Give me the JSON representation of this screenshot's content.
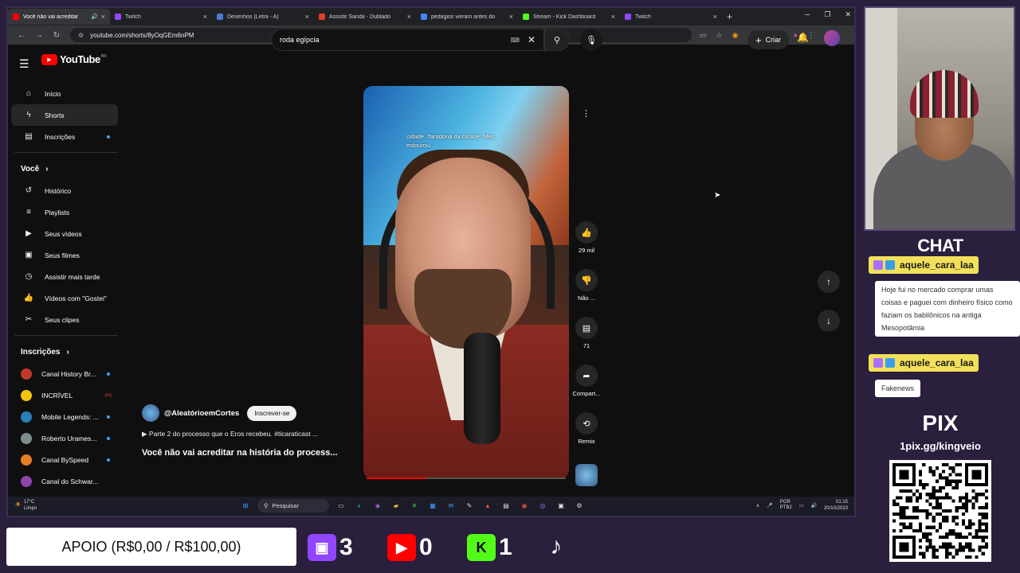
{
  "browser": {
    "tabs": [
      {
        "title": "Você não vai acreditar",
        "color": "#ff0000",
        "active": true,
        "audio": "🔊"
      },
      {
        "title": "Twitch",
        "color": "#9146ff"
      },
      {
        "title": "Desenhos (Letra - A)",
        "color": "#4a7bd6"
      },
      {
        "title": "Assistir Sanda - Dublado",
        "color": "#e63c2a"
      },
      {
        "title": "pedagios vieram antes do",
        "color": "#4285f4"
      },
      {
        "title": "Stream - Kick Dashboard",
        "color": "#53fc18"
      },
      {
        "title": "Twitch",
        "color": "#9146ff"
      }
    ],
    "newtab": "+",
    "close": "×",
    "url": "youtube.com/shorts/8yOqGEm6nPM",
    "controls": {
      "min": "─",
      "max": "❐",
      "close": "✕"
    }
  },
  "youtube": {
    "logo_text": "YouTube",
    "country": "BR",
    "search_value": "roda egípcia",
    "create_label": "Criar",
    "sidebar": {
      "main": [
        {
          "label": "Início",
          "icon": "⌂",
          "name": "home"
        },
        {
          "label": "Shorts",
          "icon": "ϟ",
          "name": "shorts",
          "selected": true
        },
        {
          "label": "Inscrições",
          "icon": "▤",
          "name": "subscriptions",
          "dot": true
        }
      ],
      "voce_header": "Você",
      "voce": [
        {
          "label": "Histórico",
          "icon": "↺",
          "name": "history"
        },
        {
          "label": "Playlists",
          "icon": "≡",
          "name": "playlists"
        },
        {
          "label": "Seus vídeos",
          "icon": "▶",
          "name": "your-videos"
        },
        {
          "label": "Seus filmes",
          "icon": "▣",
          "name": "your-movies"
        },
        {
          "label": "Assistir mais tarde",
          "icon": "◷",
          "name": "watch-later"
        },
        {
          "label": "Vídeos com \"Gostei\"",
          "icon": "👍",
          "name": "liked-videos"
        },
        {
          "label": "Seus clipes",
          "icon": "✂",
          "name": "your-clips"
        }
      ],
      "subs_header": "Inscrições",
      "subs": [
        {
          "label": "Canal History Br...",
          "color": "#c0392b",
          "dot": true
        },
        {
          "label": "INCRÍVEL",
          "color": "#f1c40f",
          "live": true
        },
        {
          "label": "Mobile Legends: ...",
          "color": "#2980b9",
          "dot": true
        },
        {
          "label": "Roberto Urames...",
          "color": "#7f8c8d",
          "dot": true
        },
        {
          "label": "Canal BySpeed",
          "color": "#e67e22",
          "dot": true
        },
        {
          "label": "Canal do Schwar...",
          "color": "#8e44ad"
        }
      ]
    },
    "short": {
      "caption": "cidade. Taradona da cidade. Meu, estourou.",
      "channel": "@AleatórioemCortes",
      "subscribe": "Inscrever-se",
      "description": "▶  Parte 2 do processo que o Eros recebeu. #ticaraticast ...",
      "title": "Você não vai acreditar na história do process...",
      "progress": 0.3
    },
    "actions": {
      "like": "29 mil",
      "dislike": "Não ...",
      "comments": "71",
      "share": "Compart...",
      "remix": "Remix"
    }
  },
  "taskbar": {
    "weather": "17°C\nLimpo",
    "search": "Pesquisar",
    "lang": "POR\nPTB2",
    "time": "01:15",
    "date": "20/10/2023"
  },
  "overlay": {
    "chat_title": "CHAT",
    "messages": [
      {
        "user": "aquele_cara_laa",
        "text": "Hoje fui no mercado comprar umas coisas e paguei com dinheiro físico como faziam os babilônicos na antiga Mesopotâmia"
      },
      {
        "user": "aquele_cara_laa",
        "text": "Fakenews"
      }
    ],
    "pix_title": "PIX",
    "pix_key": "1pix.gg/kingveio",
    "apoio": "APOIO (R$0,00 / R$100,00)",
    "twitch_count": "3",
    "youtube_count": "0",
    "kick_count": "1",
    "kick_letter": "K"
  }
}
